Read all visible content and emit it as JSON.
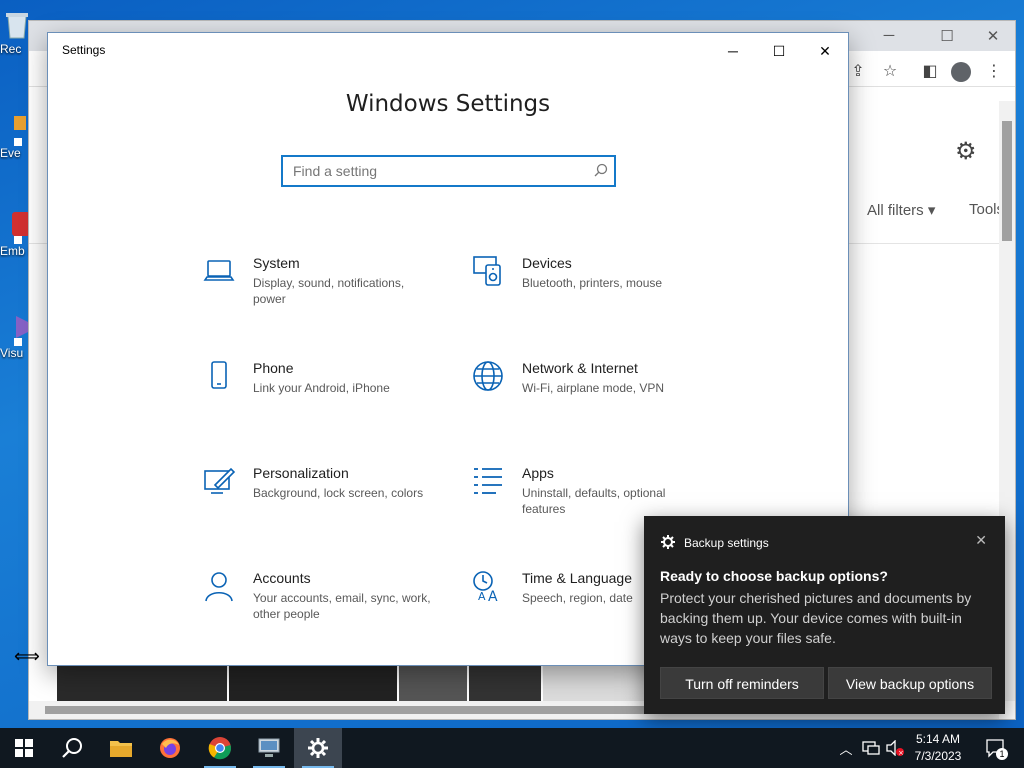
{
  "desktop": {
    "icons": [
      {
        "label": "Rec"
      },
      {
        "label": "Eve"
      },
      {
        "label": "Emb De"
      },
      {
        "label": "Visu"
      }
    ]
  },
  "browser": {
    "filters_label": "All filters",
    "tools_label": "Tools"
  },
  "settings": {
    "window_title": "Settings",
    "heading": "Windows Settings",
    "search_placeholder": "Find a setting",
    "categories": [
      {
        "name": "System",
        "desc": "Display, sound, notifications, power",
        "icon": "laptop-icon"
      },
      {
        "name": "Devices",
        "desc": "Bluetooth, printers, mouse",
        "icon": "devices-icon"
      },
      {
        "name": "Phone",
        "desc": "Link your Android, iPhone",
        "icon": "phone-icon"
      },
      {
        "name": "Network & Internet",
        "desc": "Wi-Fi, airplane mode, VPN",
        "icon": "globe-icon"
      },
      {
        "name": "Personalization",
        "desc": "Background, lock screen, colors",
        "icon": "paint-icon"
      },
      {
        "name": "Apps",
        "desc": "Uninstall, defaults, optional features",
        "icon": "apps-list-icon"
      },
      {
        "name": "Accounts",
        "desc": "Your accounts, email, sync, work, other people",
        "icon": "person-icon"
      },
      {
        "name": "Time & Language",
        "desc": "Speech, region, date",
        "icon": "time-language-icon"
      }
    ]
  },
  "toast": {
    "app": "Backup settings",
    "heading": "Ready to choose backup options?",
    "body": "Protect your cherished pictures and documents by backing them up. Your device comes with built-in ways to keep your files safe.",
    "btn_left": "Turn off reminders",
    "btn_right": "View backup options"
  },
  "taskbar": {
    "time": "5:14 AM",
    "date": "7/3/2023",
    "notification_count": "1"
  },
  "colors": {
    "accent": "#0a63b5",
    "desktop": "#1a6fc7",
    "taskbar": "#101820"
  }
}
